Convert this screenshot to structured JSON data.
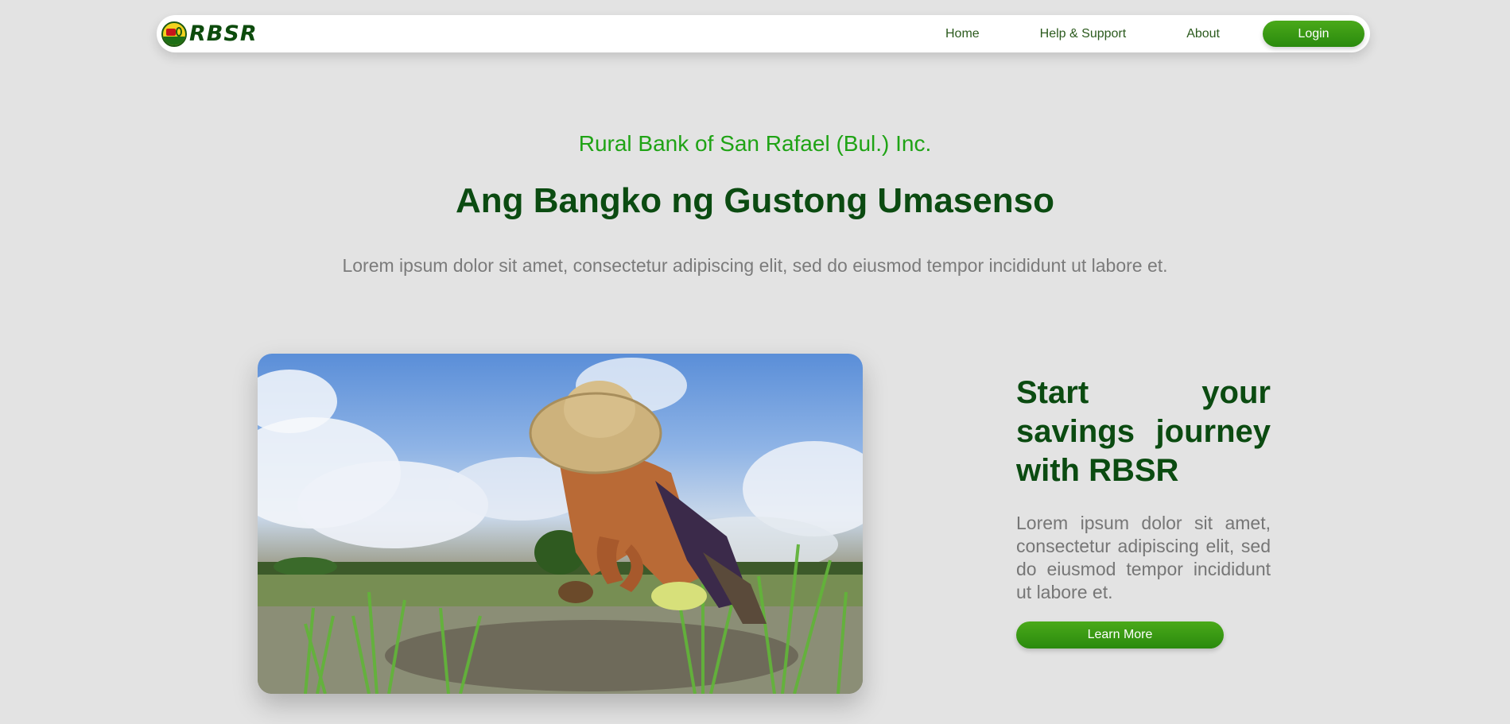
{
  "brand": {
    "name": "RBSR",
    "logo_icon": "bank-seal-logo"
  },
  "nav": {
    "home": "Home",
    "help": "Help & Support",
    "about": "About",
    "login": "Login"
  },
  "hero": {
    "subtitle": "Rural Bank of San Rafael (Bul.) Inc.",
    "title": "Ang Bangko ng Gustong Umasenso",
    "description": "Lorem ipsum dolor sit amet, consectetur adipiscing elit, sed do eiusmod tempor incididunt ut labore et."
  },
  "feature": {
    "image_alt": "farmer-planting-rice-photo",
    "title": "Start your savings journey with RBSR",
    "description": "Lorem ipsum dolor sit amet, consectetur adipiscing elit, sed do eiusmod tempor incididunt ut labore et.",
    "cta": "Learn More"
  },
  "colors": {
    "accent_green": "#2a8a0d",
    "dark_green": "#0b4b11",
    "light_green": "#1fa315",
    "background": "#e3e3e3"
  }
}
